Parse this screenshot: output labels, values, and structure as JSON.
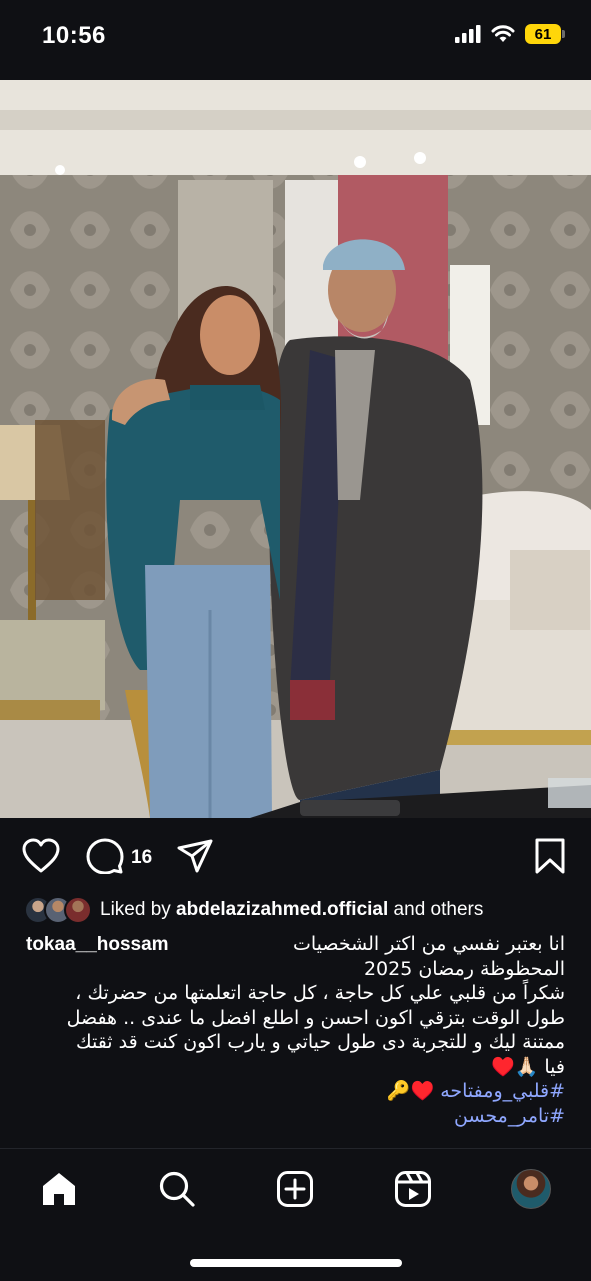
{
  "status_bar": {
    "time": "10:56",
    "battery": "61"
  },
  "post": {
    "comment_count": "16",
    "liked_by_prefix": "Liked by ",
    "liked_by_user": "abdelazizahmed.official",
    "liked_by_suffix": " and others",
    "username": "tokaa__hossam",
    "caption_lines": [
      "انا بعتبر نفسي من اكتر الشخصيات",
      "المحظوظة رمضان 2025",
      "شكراً من قلبي علي كل حاجة ، كل حاجة اتعلمتها من حضرتك ،",
      "طول الوقت بتزقي اكون احسن و اطلع افضل ما عندى .. هفضل",
      "ممتنة ليك و للتجربة دى طول حياتي و يارب اكون كنت قد ثقتك",
      "فيا 🙏🏻♥️"
    ],
    "hashtags": [
      "#قلبي_ومفتاحه ♥️🔑",
      "#تامر_محسن"
    ]
  },
  "colors": {
    "background": "#0f1014",
    "battery": "#ffd60a",
    "hashtag": "#8fa7ff"
  },
  "icons": [
    "signal-icon",
    "wifi-icon",
    "battery-icon",
    "heart-icon",
    "comment-icon",
    "share-icon",
    "bookmark-icon",
    "home-icon",
    "search-icon",
    "create-icon",
    "reels-icon",
    "profile-avatar"
  ]
}
